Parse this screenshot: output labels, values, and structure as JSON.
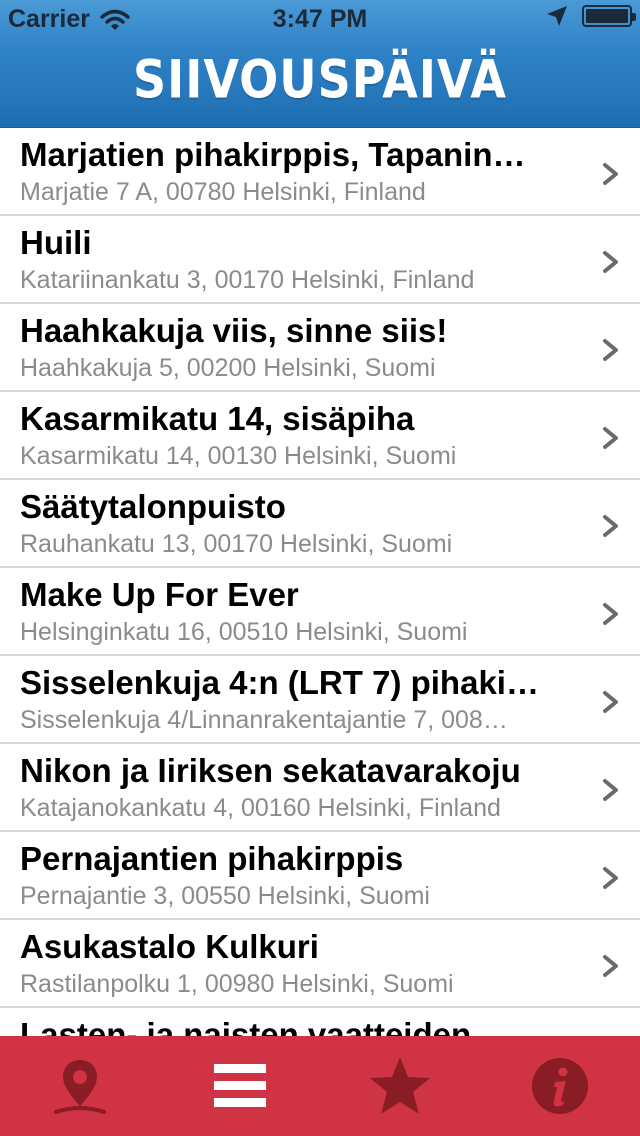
{
  "status_bar": {
    "carrier": "Carrier",
    "time": "3:47 PM"
  },
  "nav": {
    "title": "SIIVOUSPÄIVÄ"
  },
  "events": [
    {
      "title": "Marjatien pihakirppis, Tapanin…",
      "address": "Marjatie 7 A, 00780 Helsinki, Finland"
    },
    {
      "title": "Huili",
      "address": "Katariinankatu 3, 00170 Helsinki, Finland"
    },
    {
      "title": "Haahkakuja viis, sinne siis!",
      "address": "Haahkakuja 5, 00200 Helsinki, Suomi"
    },
    {
      "title": "Kasarmikatu 14, sisäpiha",
      "address": "Kasarmikatu 14, 00130 Helsinki, Suomi"
    },
    {
      "title": "Säätytalonpuisto",
      "address": "Rauhankatu 13, 00170 Helsinki, Suomi"
    },
    {
      "title": "Make Up For Ever",
      "address": "Helsinginkatu 16, 00510 Helsinki, Suomi"
    },
    {
      "title": "Sisselenkuja 4:n (LRT 7) pihaki…",
      "address": "Sisselenkuja 4/Linnanrakentajantie 7, 008…"
    },
    {
      "title": "Nikon ja Iiriksen sekatavarakoju",
      "address": "Katajanokankatu 4, 00160 Helsinki, Finland"
    },
    {
      "title": "Pernajantien pihakirppis",
      "address": "Pernajantie 3, 00550 Helsinki, Suomi"
    },
    {
      "title": "Asukastalo Kulkuri",
      "address": "Rastilanpolku 1, 00980 Helsinki, Suomi"
    },
    {
      "title": "Lasten- ja naisten vaatteiden",
      "address": ""
    }
  ],
  "tabbar": {
    "color": "#d03343",
    "icon_color": "#8a1c26",
    "active_icon_color": "#ffffff",
    "tabs": [
      {
        "icon": "map-pin-icon",
        "active": false
      },
      {
        "icon": "list-icon",
        "active": true
      },
      {
        "icon": "star-icon",
        "active": false
      },
      {
        "icon": "info-icon",
        "active": false
      }
    ]
  }
}
